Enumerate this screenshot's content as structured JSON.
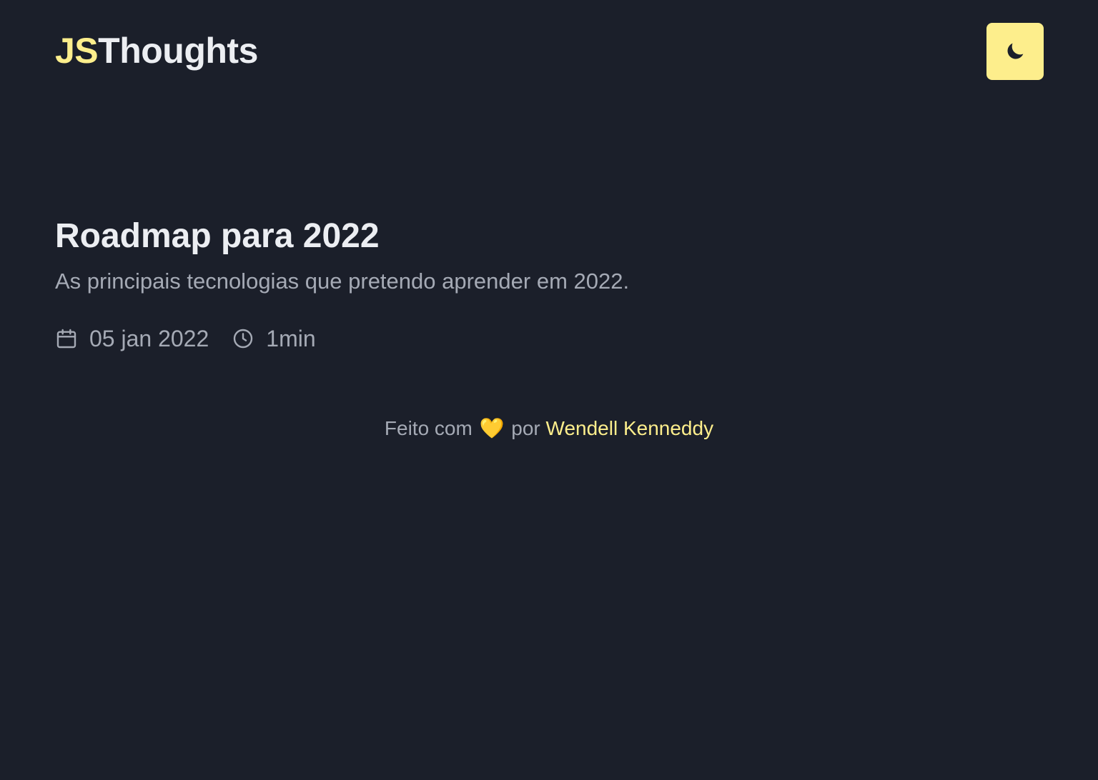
{
  "header": {
    "logo_accent": "JS",
    "logo_rest": "Thoughts",
    "theme_toggle_icon": "moon-icon",
    "accent_color": "#fdee8c"
  },
  "post": {
    "title": "Roadmap para 2022",
    "description": "As principais tecnologias que pretendo aprender em 2022.",
    "date": "05 jan 2022",
    "date_icon": "calendar-icon",
    "reading_time": "1min",
    "reading_time_icon": "clock-icon"
  },
  "footer": {
    "made_with": "Feito com",
    "heart": "💛",
    "by": "por",
    "author": "Wendell Kenneddy"
  },
  "colors": {
    "background": "#1b1f2a",
    "text_primary": "#eceef2",
    "text_secondary": "#a5aab5",
    "accent": "#fdee8c"
  }
}
